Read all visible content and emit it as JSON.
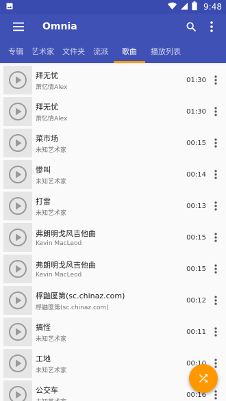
{
  "status_bar": {
    "time": "9:48"
  },
  "app_bar": {
    "title": "Omnia",
    "menu_icon": "hamburger-icon",
    "search_icon": "search-icon",
    "overflow_icon": "more-vert-icon"
  },
  "tabs": [
    {
      "label": "专辑"
    },
    {
      "label": "艺术家"
    },
    {
      "label": "文件夹"
    },
    {
      "label": "流派"
    },
    {
      "label": "歌曲",
      "active": true
    },
    {
      "label": "播放列表"
    }
  ],
  "songs": [
    {
      "title": "拜无忧",
      "artist": "萧忆情Alex",
      "duration": "01:30"
    },
    {
      "title": "拜无忧",
      "artist": "萧忆情Alex",
      "duration": "01:30"
    },
    {
      "title": "菜市场",
      "artist": "未知艺术家",
      "duration": "00:15"
    },
    {
      "title": "惨叫",
      "artist": "未知艺术家",
      "duration": "00:14"
    },
    {
      "title": "打雷",
      "artist": "未知艺术家",
      "duration": "00:13"
    },
    {
      "title": "弗朗明戈风吉他曲",
      "artist": "Kevin MacLeod",
      "duration": "00:15"
    },
    {
      "title": "弗朗明戈风吉他曲",
      "artist": "Kevin MacLeod",
      "duration": "00:15"
    },
    {
      "title": "桴鼬匽第(sc.chinaz.com)",
      "artist": "桴鼬匽第(sc.chinaz.com)",
      "duration": "00:12"
    },
    {
      "title": "搞怪",
      "artist": "未知艺术家",
      "duration": "00:11"
    },
    {
      "title": "工地",
      "artist": "未知艺术家",
      "duration": "00:10"
    },
    {
      "title": "公交车",
      "artist": "未知艺术家",
      "duration": "00:16"
    }
  ],
  "fab": {
    "icon": "shuffle-icon"
  },
  "colors": {
    "primary": "#3f51b5",
    "accent": "#ff9800"
  }
}
